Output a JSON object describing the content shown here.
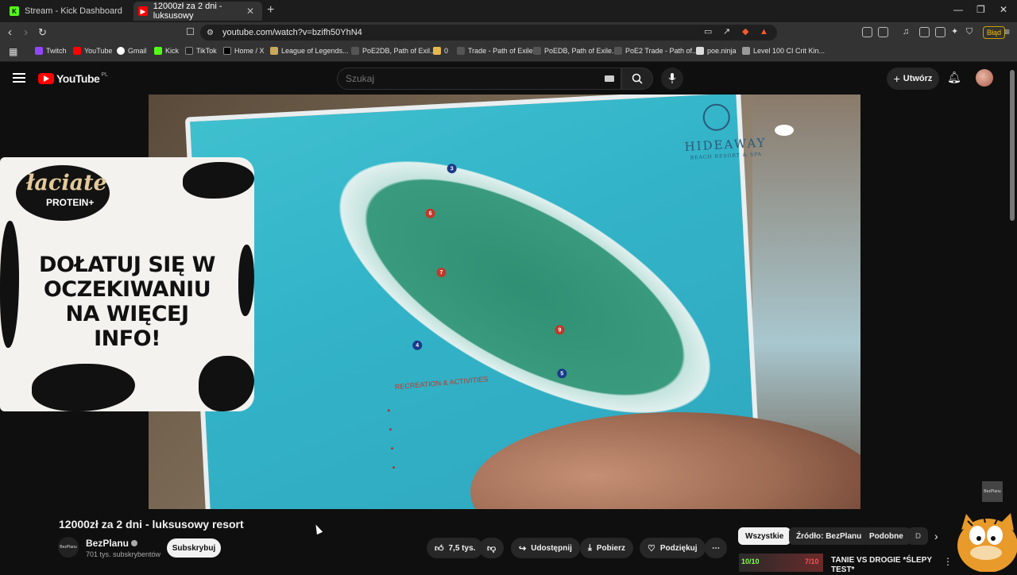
{
  "browser": {
    "tabs": [
      {
        "label": "Stream - Kick Dashboard",
        "icon": "kick-icon"
      },
      {
        "label": "12000zł za 2 dni - luksusowy",
        "icon": "youtube-icon"
      }
    ],
    "url": "youtube.com/watch?v=bzifh50YhN4",
    "profile_label": "Błąd",
    "bookmarks": [
      "Twitch",
      "YouTube",
      "Gmail",
      "Kick",
      "TikTok",
      "Home / X",
      "League of Legends...",
      "PoE2DB, Path of Exil...",
      "0",
      "Trade - Path of Exile",
      "PoEDB, Path of Exile...",
      "PoE2 Trade - Path of...",
      "poe.ninja",
      "Level 100 CI Crit Kin..."
    ]
  },
  "youtube": {
    "logo": "YouTube",
    "region": "PL",
    "search_placeholder": "Szukaj",
    "create_label": "Utwórz"
  },
  "video": {
    "map_brand": "HIDEAWAY",
    "map_sub": "BEACH RESORT & SPA",
    "map_section": "RECREATION & ACTIVITIES",
    "overlay": {
      "logo": "łaciate",
      "logo_sub": "PROTEIN+",
      "message": "DOŁATUJ SIĘ W OCZEKIWANIU NA WIĘCEJ INFO!"
    },
    "watermark": "BezPlanu"
  },
  "meta": {
    "title": "12000zł za 2 dni - luksusowy resort",
    "channel": "BezPlanu",
    "channel_avatar": "BezPlanu",
    "subscribers": "701 tys. subskrybentów",
    "subscribe": "Subskrybuj",
    "likes": "7,5 tys.",
    "share": "Udostępnij",
    "download": "Pobierz",
    "thanks": "Podziękuj"
  },
  "chips": [
    "Wszystkie",
    "Źródło: BezPlanu",
    "Podobne",
    "D"
  ],
  "recommended": {
    "title": "TANIE VS DROGIE *ŚLEPY TEST*",
    "score_left": "10/10",
    "score_right": "7/10"
  },
  "colors": {
    "accent": "#ff0000",
    "background": "#0f0f0f"
  }
}
